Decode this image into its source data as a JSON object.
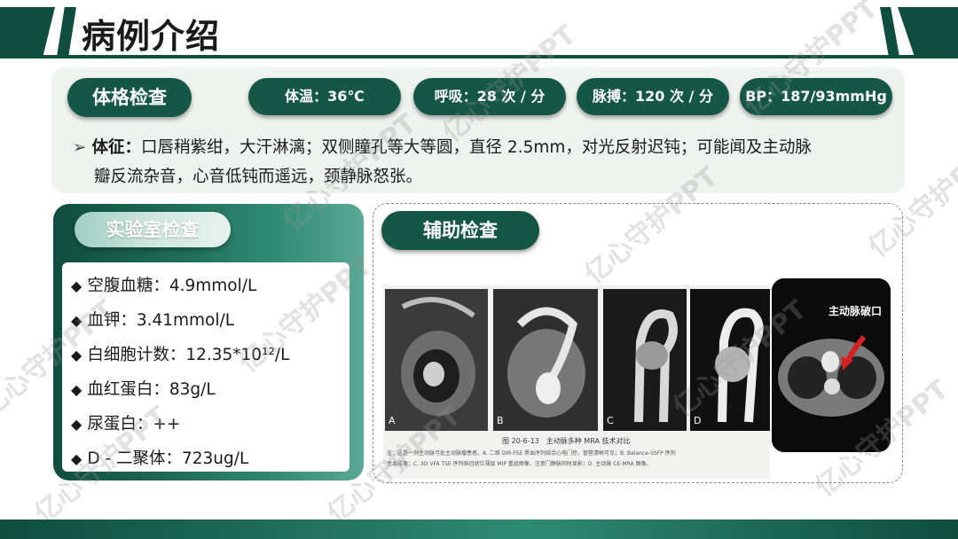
{
  "header": {
    "title": "病例介绍"
  },
  "physical_exam": {
    "label": "体格检查",
    "vitals": [
      {
        "text": "体温：36℃"
      },
      {
        "text": "呼吸：28 次 / 分"
      },
      {
        "text": "脉搏：120 次 / 分"
      },
      {
        "text": "BP：187/93mmHg"
      }
    ],
    "signs_label": "体征：",
    "signs_line1": "口唇稍紫绀，大汗淋漓；双侧瞳孔等大等圆，直径 2.5mm，对光反射迟钝；可能闻及主动脉",
    "signs_line2": "瓣反流杂音，心音低钝而遥远，颈静脉怒张。"
  },
  "lab_exam": {
    "label": "实验室检查",
    "items": [
      {
        "text": "空腹血糖：4.9mmol/L"
      },
      {
        "text": "血钾：3.41mmol/L"
      },
      {
        "text": "白细胞计数：12.35*10¹²/L"
      },
      {
        "text": "血红蛋白：83g/L"
      },
      {
        "text": "尿蛋白：++"
      },
      {
        "text": "D - 二聚体：723ug/L"
      }
    ]
  },
  "aux_exam": {
    "label": "辅助检查",
    "ct_label": "主动脉破口",
    "figure_caption": "图 20-6-13　主动脉多种 MRA 技术对比",
    "figure_note_1": "注：这是一例主动脉弓处主动脉瘤患者。A. 二维 DIR-FSE 黑血序列结合心电门控，管壁清晰可见；B. Balance-SSFP 序列",
    "figure_note_2": "亮血成像；C. 3D VFA TSE 序列斜冠状位薄层 MIP 重组图像，注意门静脉同时显影；D. 主动脉 CE-MRA 图像。",
    "panel_letters": [
      "A",
      "B",
      "C",
      "D"
    ]
  },
  "watermark": "亿心守护PPT",
  "colors": {
    "primary": "#0f4d3e",
    "accent": "#155646",
    "panel_bg": "#eef3ef"
  }
}
